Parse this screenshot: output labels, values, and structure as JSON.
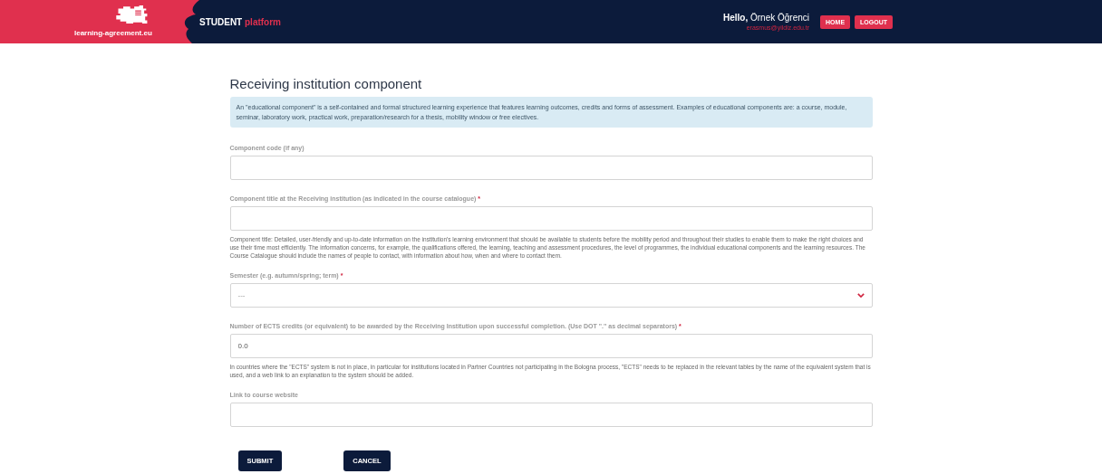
{
  "header": {
    "logo_text": "learning-agreement.eu",
    "product": {
      "strong": "STUDENT",
      "accent": "platform"
    },
    "greeting": "Hello,",
    "user_name": "Örnek Öğrenci",
    "user_email": "erasmus@yildiz.edu.tr",
    "buttons": [
      "HOME",
      "LOGOUT"
    ]
  },
  "title": "Receiving institution component",
  "info": "An \"educational component\" is a self-contained and formal structured learning experience that features learning outcomes, credits and forms of assessment. Examples of educational components are: a course, module, seminar, laboratory work, practical work, preparation/research for a thesis, mobility window or free electives.",
  "fields": [
    {
      "kind": "text",
      "label": "Component code (if any)"
    },
    {
      "kind": "text",
      "label": "Component title at the Receiving institution (as indicated in the course catalogue)",
      "required_mark": "*",
      "help": "Component title: Detailed, user-friendly and up-to-date information on the institution's learning environment that should be available to students before the mobility period and throughout their studies to enable them to make the right choices and use their time most efficiently. The information concerns, for example, the qualifications offered, the learning, teaching and assessment procedures, the level of programmes, the individual educational components and the learning resources. The Course Catalogue should include the names of people to contact, with information about how, when and where to contact them."
    },
    {
      "kind": "select",
      "label": "Semester (e.g. autumn/spring; term)",
      "required_mark": "*",
      "value": "---"
    },
    {
      "kind": "text",
      "label": "Number of ECTS credits (or equivalent) to be awarded by the Receiving Institution upon successful completion. (Use DOT \".\" as decimal separators)",
      "required_mark": "*",
      "value": "0.0",
      "help": "In countries where the \"ECTS\" system is not in place, in particular for institutions located in Partner Countries not participating in the Bologna process, \"ECTS\" needs to be replaced in the relevant tables by the name of the equivalent system that is used, and a web link to an explanation to the system should be added."
    },
    {
      "kind": "text",
      "label": "Link to course website"
    }
  ],
  "actions": [
    "SUBMIT",
    "CANCEL"
  ]
}
